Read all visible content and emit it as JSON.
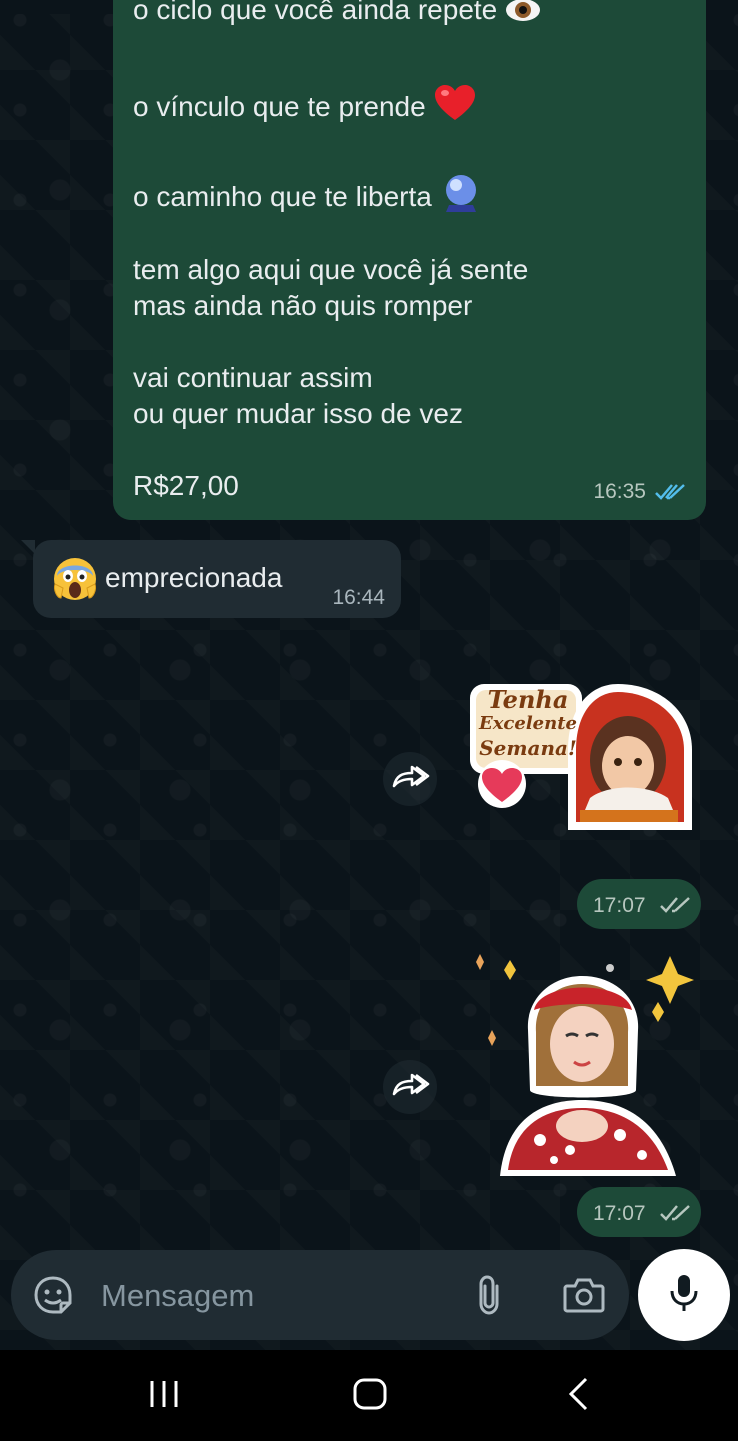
{
  "outgoing_message": {
    "lines": [
      "o ciclo que você ainda repete",
      "o vínculo que te prende",
      "o caminho que te liberta",
      "tem algo aqui que você já sente",
      "mas ainda não quis romper",
      "vai continuar assim",
      "ou quer mudar isso de vez",
      "R$27,00"
    ],
    "time": "16:35",
    "status": "read",
    "status_color": "#53bdeb"
  },
  "incoming_message": {
    "text": "emprecionada",
    "time": "16:44",
    "emoji": "face-screaming-in-fear"
  },
  "stickers": [
    {
      "name": "tenha-excelente-semana-sticker",
      "caption_lines": [
        "Tenha",
        "Excelente",
        "Semana!"
      ],
      "time": "17:07",
      "status": "delivered"
    },
    {
      "name": "woman-red-cap-sticker",
      "time": "17:07",
      "status": "delivered"
    }
  ],
  "composer": {
    "placeholder": "Mensagem",
    "icons": [
      "sticker-icon",
      "attach-icon",
      "camera-icon",
      "mic-icon"
    ]
  },
  "colors": {
    "outgoing_bubble": "#1d4a38",
    "incoming_bubble": "#202c33",
    "background": "#0b141a"
  }
}
